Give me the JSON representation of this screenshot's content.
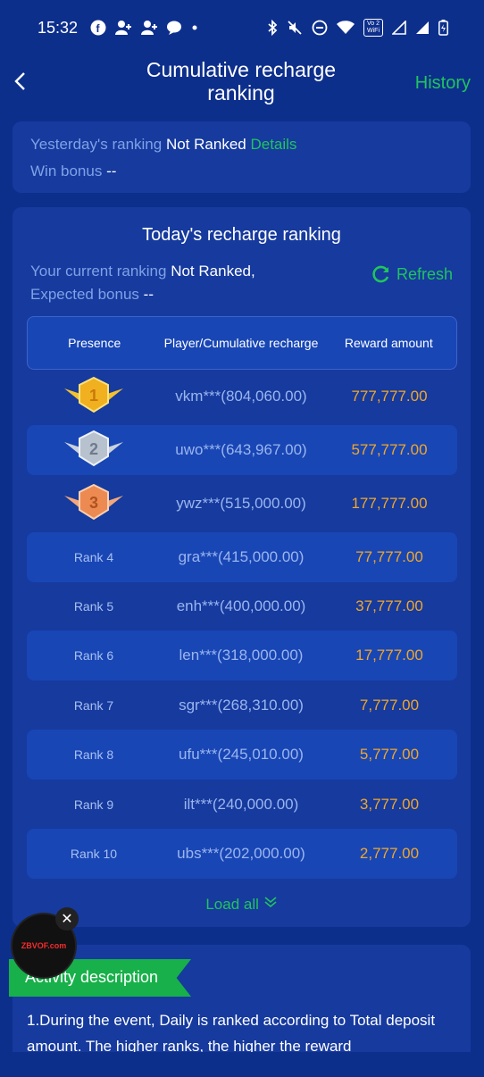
{
  "status_bar": {
    "time": "15:32",
    "left_icons": [
      "facebook-icon",
      "person-add-icon",
      "person-add-icon",
      "chat-icon",
      "dot-icon"
    ],
    "right_icons": [
      "bluetooth-icon",
      "mute-icon",
      "dnd-icon",
      "wifi-icon",
      "volte-icon",
      "signal-icon",
      "signal-icon",
      "battery-icon"
    ],
    "volte_label": "Vo 2 WiFi"
  },
  "header": {
    "title": "Cumulative recharge ranking",
    "history_label": "History"
  },
  "yesterday": {
    "ranking_label": "Yesterday's ranking",
    "ranking_value": "Not Ranked",
    "details_label": "Details",
    "win_bonus_label": "Win bonus",
    "win_bonus_value": "--"
  },
  "today": {
    "title": "Today's recharge ranking",
    "current_label": "Your current ranking",
    "current_value": "Not Ranked,",
    "expected_label": "Expected bonus",
    "expected_value": "--",
    "refresh_label": "Refresh",
    "columns": [
      "Presence",
      "Player/Cumulative recharge",
      "Reward amount"
    ],
    "rows": [
      {
        "rank": "1",
        "player": "vkm***(804,060.00)",
        "reward": "777,777.00"
      },
      {
        "rank": "2",
        "player": "uwo***(643,967.00)",
        "reward": "577,777.00"
      },
      {
        "rank": "3",
        "player": "ywz***(515,000.00)",
        "reward": "177,777.00"
      },
      {
        "rank": "Rank 4",
        "player": "gra***(415,000.00)",
        "reward": "77,777.00"
      },
      {
        "rank": "Rank 5",
        "player": "enh***(400,000.00)",
        "reward": "37,777.00"
      },
      {
        "rank": "Rank 6",
        "player": "len***(318,000.00)",
        "reward": "17,777.00"
      },
      {
        "rank": "Rank 7",
        "player": "sgr***(268,310.00)",
        "reward": "7,777.00"
      },
      {
        "rank": "Rank 8",
        "player": "ufu***(245,010.00)",
        "reward": "5,777.00"
      },
      {
        "rank": "Rank 9",
        "player": "ilt***(240,000.00)",
        "reward": "3,777.00"
      },
      {
        "rank": "Rank 10",
        "player": "ubs***(202,000.00)",
        "reward": "2,777.00"
      }
    ],
    "load_all_label": "Load all"
  },
  "activity": {
    "ribbon_label": "Activity description",
    "text": "1.During the event, Daily is ranked according to Total deposit amount. The higher  ranks, the higher the reward"
  },
  "float_ad": {
    "logo_text": "ZBVOF.com",
    "close_icon": "close-icon"
  },
  "colors": {
    "background": "#0d2f8c",
    "card": "#163a9e",
    "accent_green": "#21c45e",
    "reward_gold": "#f0a72a",
    "muted_text": "#7fa2e6"
  }
}
